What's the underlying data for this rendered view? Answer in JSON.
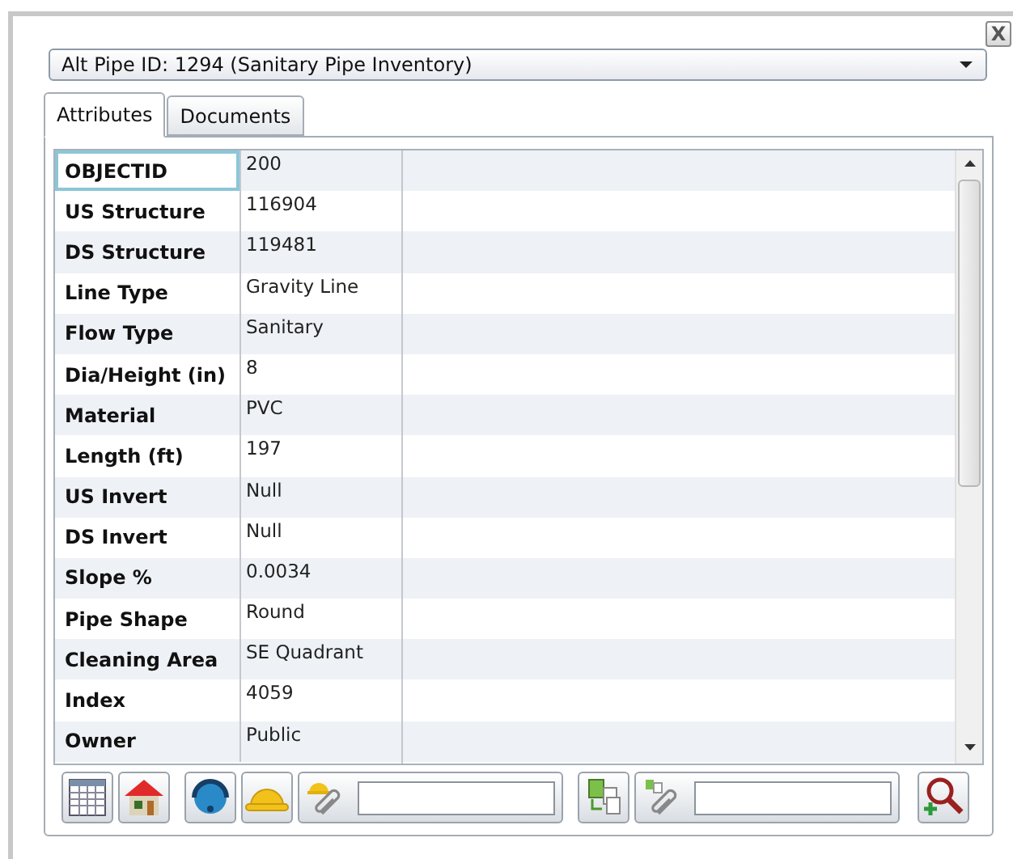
{
  "close_button": {
    "label": "X"
  },
  "dropdown": {
    "value": "Alt Pipe ID: 1294 (Sanitary Pipe Inventory)"
  },
  "tabs": [
    {
      "label": "Attributes",
      "selected": true
    },
    {
      "label": "Documents",
      "selected": false
    }
  ],
  "attributes": [
    {
      "label": "OBJECTID",
      "value": "200",
      "selected": true
    },
    {
      "label": "US Structure",
      "value": "116904",
      "selected": false
    },
    {
      "label": "DS Structure",
      "value": "119481",
      "selected": false
    },
    {
      "label": "Line Type",
      "value": "Gravity Line",
      "selected": false
    },
    {
      "label": "Flow Type",
      "value": "Sanitary",
      "selected": false
    },
    {
      "label": "Dia/Height (in)",
      "value": "8",
      "selected": false
    },
    {
      "label": "Material",
      "value": "PVC",
      "selected": false
    },
    {
      "label": "Length (ft)",
      "value": "197",
      "selected": false
    },
    {
      "label": "US Invert",
      "value": "Null",
      "selected": false
    },
    {
      "label": "DS Invert",
      "value": "Null",
      "selected": false
    },
    {
      "label": "Slope %",
      "value": "0.0034",
      "selected": false
    },
    {
      "label": "Pipe Shape",
      "value": "Round",
      "selected": false
    },
    {
      "label": "Cleaning Area",
      "value": "SE Quadrant",
      "selected": false
    },
    {
      "label": "Index",
      "value": "4059",
      "selected": false
    },
    {
      "label": "Owner",
      "value": "Public",
      "selected": false
    }
  ]
}
